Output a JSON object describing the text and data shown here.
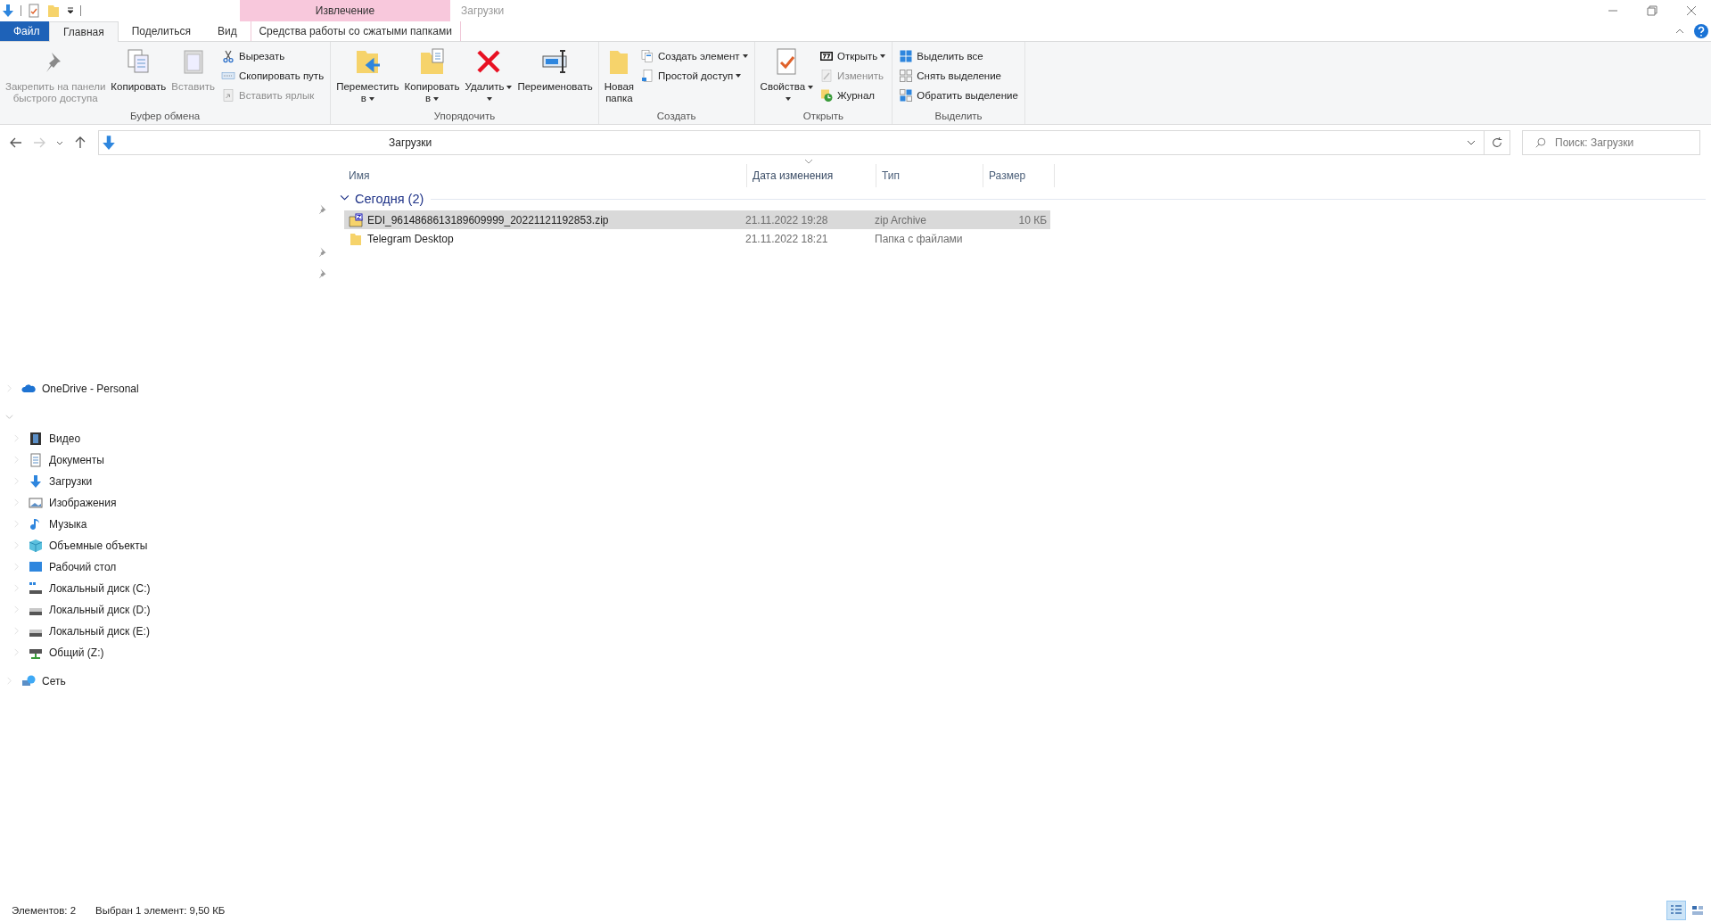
{
  "window": {
    "title": "Загрузки",
    "context_tab_group": "Извлечение"
  },
  "ribbon_tabs": [
    {
      "label": "Файл",
      "kind": "file",
      "selected": false
    },
    {
      "label": "Главная",
      "kind": "normal",
      "selected": true
    },
    {
      "label": "Поделиться",
      "kind": "normal",
      "selected": false
    },
    {
      "label": "Вид",
      "kind": "normal",
      "selected": false
    },
    {
      "label": "Средства работы со сжатыми папками",
      "kind": "context",
      "selected": false
    }
  ],
  "ribbon_groups": [
    {
      "label": "Буфер обмена",
      "items": [
        {
          "kind": "large",
          "lines": [
            "Закрепить на панели",
            "быстрого доступа"
          ],
          "disabled": true,
          "dropdown": false
        },
        {
          "kind": "large",
          "lines": [
            "Копировать"
          ],
          "disabled": false,
          "dropdown": false
        },
        {
          "kind": "large",
          "lines": [
            "Вставить"
          ],
          "disabled": true,
          "dropdown": false
        },
        {
          "kind": "small",
          "lines": [
            "Вырезать"
          ],
          "disabled": false,
          "dropdown": false
        },
        {
          "kind": "small",
          "lines": [
            "Скопировать путь"
          ],
          "disabled": false,
          "dropdown": false
        },
        {
          "kind": "small",
          "lines": [
            "Вставить ярлык"
          ],
          "disabled": true,
          "dropdown": false
        }
      ]
    },
    {
      "label": "Упорядочить",
      "items": [
        {
          "kind": "large",
          "lines": [
            "Переместить",
            "в"
          ],
          "disabled": false,
          "dropdown": true
        },
        {
          "kind": "large",
          "lines": [
            "Копировать",
            "в"
          ],
          "disabled": false,
          "dropdown": true
        },
        {
          "kind": "large",
          "lines": [
            "Удалить"
          ],
          "disabled": false,
          "dropdown": true
        },
        {
          "kind": "large",
          "lines": [
            "Переименовать"
          ],
          "disabled": false,
          "dropdown": false
        }
      ]
    },
    {
      "label": "Создать",
      "items": [
        {
          "kind": "large",
          "lines": [
            "Новая",
            "папка"
          ],
          "disabled": false,
          "dropdown": false
        },
        {
          "kind": "small",
          "lines": [
            "Создать элемент"
          ],
          "disabled": false,
          "dropdown": true
        },
        {
          "kind": "small",
          "lines": [
            "Простой доступ"
          ],
          "disabled": false,
          "dropdown": true
        }
      ]
    },
    {
      "label": "Открыть",
      "items": [
        {
          "kind": "large",
          "lines": [
            "Свойства"
          ],
          "disabled": false,
          "dropdown": true
        },
        {
          "kind": "small",
          "lines": [
            "Открыть"
          ],
          "disabled": false,
          "dropdown": true
        },
        {
          "kind": "small",
          "lines": [
            "Изменить"
          ],
          "disabled": true,
          "dropdown": false
        },
        {
          "kind": "small",
          "lines": [
            "Журнал"
          ],
          "disabled": false,
          "dropdown": false
        }
      ]
    },
    {
      "label": "Выделить",
      "items": [
        {
          "kind": "small",
          "lines": [
            "Выделить все"
          ],
          "disabled": false,
          "dropdown": false
        },
        {
          "kind": "small",
          "lines": [
            "Снять выделение"
          ],
          "disabled": false,
          "dropdown": false
        },
        {
          "kind": "small",
          "lines": [
            "Обратить выделение"
          ],
          "disabled": false,
          "dropdown": false
        }
      ]
    }
  ],
  "address_bar": {
    "path": "Загрузки"
  },
  "search": {
    "placeholder": "Поиск: Загрузки"
  },
  "navigation": [
    {
      "label": "OneDrive - Personal",
      "expanded": false
    },
    {
      "expanded": true,
      "children": [
        {
          "label": "Видео",
          "expanded": false
        },
        {
          "label": "Документы",
          "expanded": false
        },
        {
          "label": "Загрузки",
          "expanded": false
        },
        {
          "label": "Изображения",
          "expanded": false
        },
        {
          "label": "Музыка",
          "expanded": false
        },
        {
          "label": "Объемные объекты",
          "expanded": false
        },
        {
          "label": "Рабочий стол",
          "expanded": false
        },
        {
          "label": "Локальный диск (C:)",
          "expanded": false
        },
        {
          "label": "Локальный диск (D:)",
          "expanded": false
        },
        {
          "label": "Локальный диск (E:)",
          "expanded": false
        },
        {
          "label": "Общий (Z:)",
          "expanded": false
        }
      ]
    },
    {
      "label": "Сеть",
      "expanded": false
    }
  ],
  "file_list": {
    "columns": [
      {
        "label": "Имя",
        "sorted": false
      },
      {
        "label": "Дата изменения",
        "sorted": true
      },
      {
        "label": "Тип",
        "sorted": false
      },
      {
        "label": "Размер",
        "sorted": false
      }
    ],
    "groups": [
      {
        "label": "Сегодня (2)",
        "expanded": true,
        "rows": [
          {
            "kind": "zip",
            "name": "EDI_9614868613189609999_20221121192853.zip",
            "date": "21.11.2022 19:28",
            "type": "zip Archive",
            "size": "10 КБ",
            "selected": true
          },
          {
            "kind": "folder",
            "name": "Telegram Desktop",
            "date": "21.11.2022 18:21",
            "type": "Папка с файлами",
            "size": "",
            "selected": false
          }
        ]
      }
    ]
  },
  "status_bar": {
    "item_count": "Элементов: 2",
    "selection": "Выбран 1 элемент: 9,50 КБ",
    "views": [
      {
        "selected": true
      },
      {
        "selected": false
      }
    ]
  }
}
